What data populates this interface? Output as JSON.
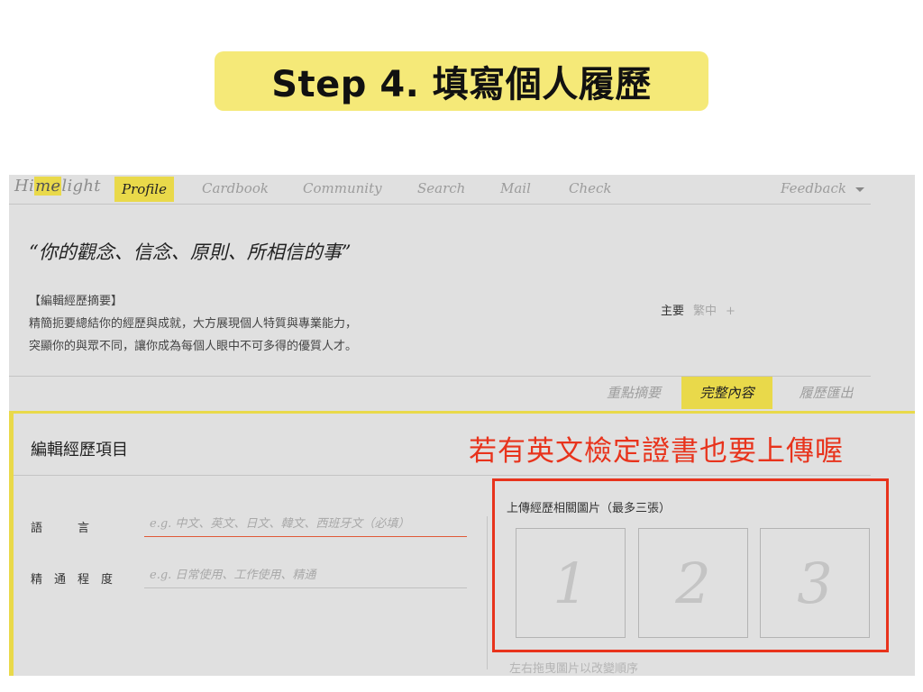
{
  "banner": {
    "title": "Step 4. 填寫個人履歷"
  },
  "nav": {
    "logo_pre": "Hi",
    "logo_mark": "me",
    "logo_post": "light",
    "items": [
      "Profile",
      "Cardbook",
      "Community",
      "Search",
      "Mail",
      "Check"
    ],
    "active_index": 0,
    "feedback": "Feedback"
  },
  "profile": {
    "quote": "“你的觀念、信念、原則、所相信的事”",
    "summary_heading": "【編輯經歷摘要】",
    "summary_line1": "精簡扼要總結你的經歷與成就，大方展現個人特質與專業能力，",
    "summary_line2": "突顯你的與眾不同，讓你成為每個人眼中不可多得的優質人才。",
    "lang_primary": "主要",
    "lang_secondary": "繁中",
    "lang_add": "+"
  },
  "tabs": {
    "items": [
      "重點摘要",
      "完整內容",
      "履歷匯出"
    ],
    "active_index": 1
  },
  "editor": {
    "title": "編輯經歷項目",
    "language_label": "語　　　言",
    "language_placeholder": "e.g. 中文、英文、日文、韓文、西班牙文（必填）",
    "language_value": "",
    "proficiency_label": "精　通　程　度",
    "proficiency_placeholder": "e.g. 日常使用、工作使用、精通",
    "proficiency_value": "",
    "upload_label": "上傳經歷相關圖片（最多三張）",
    "slots": [
      "1",
      "2",
      "3"
    ],
    "drag_hint": "左右拖曳圖片以改變順序"
  },
  "annotation": {
    "callout": "若有英文檢定證書也要上傳喔"
  },
  "colors": {
    "accent_yellow": "#e9d94a",
    "banner_yellow": "#f5e978",
    "annotation_red": "#e8331c",
    "app_bg": "#e0e0e0"
  }
}
